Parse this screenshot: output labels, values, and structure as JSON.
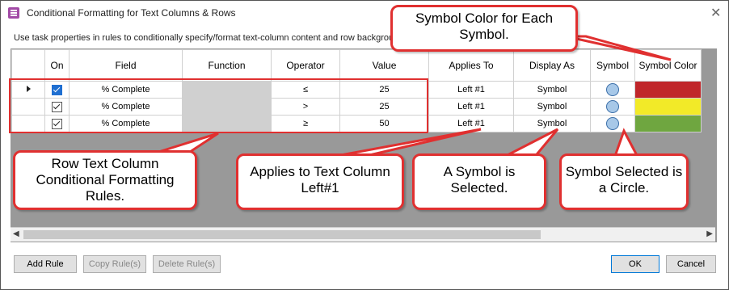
{
  "window": {
    "title": "Conditional Formatting for Text Columns & Rows",
    "close_glyph": "✕",
    "instruction": "Use task properties in rules to conditionally specify/format text-column content and row background"
  },
  "grid": {
    "columns": [
      "On",
      "Field",
      "Function",
      "Operator",
      "Value",
      "Applies To",
      "Display As",
      "Symbol",
      "Symbol Color"
    ],
    "rows": [
      {
        "on": true,
        "field": "% Complete",
        "function": "",
        "operator": "≤",
        "value": "25",
        "applies_to": "Left #1",
        "display_as": "Symbol",
        "symbol": "circle",
        "symbol_color": "#c0262a",
        "selected": true
      },
      {
        "on": true,
        "field": "% Complete",
        "function": "",
        "operator": ">",
        "value": "25",
        "applies_to": "Left #1",
        "display_as": "Symbol",
        "symbol": "circle",
        "symbol_color": "#f2ea28",
        "selected": false
      },
      {
        "on": true,
        "field": "% Complete",
        "function": "",
        "operator": "≥",
        "value": "50",
        "applies_to": "Left #1",
        "display_as": "Symbol",
        "symbol": "circle",
        "symbol_color": "#6fa640",
        "selected": false
      }
    ]
  },
  "buttons": {
    "add_rule": "Add Rule",
    "copy_rule": "Copy Rule(s)",
    "delete_rule": "Delete Rule(s)",
    "ok": "OK",
    "cancel": "Cancel"
  },
  "callouts": {
    "symbol_color": "Symbol Color for Each Symbol.",
    "row_text": "Row Text Column Conditional Formatting Rules.",
    "applies_to": "Applies to Text Column Left#1",
    "symbol_selected": "A Symbol is Selected.",
    "circle": "Symbol Selected is a Circle."
  },
  "colors": {
    "callout_border": "#e03030",
    "accent": "#0078d7"
  }
}
